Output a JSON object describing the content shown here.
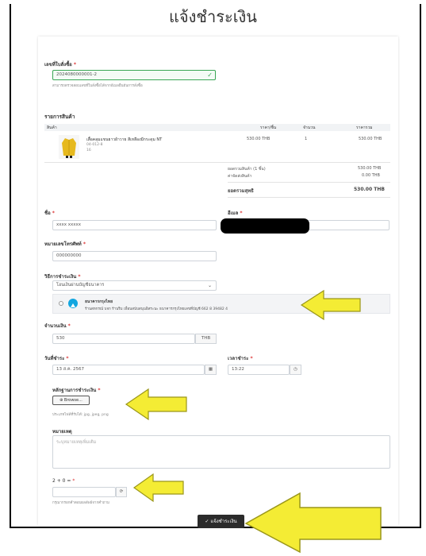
{
  "page": {
    "title": "แจ้งชำระเงิน"
  },
  "order": {
    "label": "เลขที่ใบสั่งซื้อ",
    "value": "2024080000001-2",
    "help": "สามารถตรวจสอบเลขที่ใบสั่งซื้อได้จากอีเมลยืนยันการสั่งซื้อ"
  },
  "items": {
    "section_title": "รายการสินค้า",
    "headers": {
      "product": "สินค้า",
      "price": "ราคา/ชิ้น",
      "qty": "จำนวน",
      "total": "ราคารวม"
    },
    "rows": [
      {
        "name": "เสื้อคลุมแขนยาวผ้าวาย สีเหลืองมีกระดุม NT",
        "sku": "04-012-8",
        "variant": "16",
        "price": "530.00 THB",
        "qty": "1",
        "total": "530.00 THB"
      }
    ],
    "subtotal_label": "ยอดรวมสินค้า (1 ชิ้น)",
    "subtotal_value": "530.00 THB",
    "shipping_label": "ค่าจัดส่งสินค้า",
    "shipping_value": "0.00 THB",
    "grand_label": "ยอดรวมสุทธิ",
    "grand_value": "530.00 THB"
  },
  "name": {
    "label": "ชื่อ",
    "value": "xxxx xxxxx"
  },
  "email": {
    "label": "อีเมล"
  },
  "phone": {
    "label": "หมายเลขโทรศัพท์",
    "value": "000000000"
  },
  "method": {
    "label": "วิธีการชำระเงิน",
    "selected": "โอนเงินผ่านบัญชีธนาคาร",
    "bank_name": "ธนาคารกรุงไทย",
    "bank_detail": "ร้านสหกรณ์ บจก ร้านริม เพื่อนสนับสนุนอิสระนะ ธนาคารกรุงไทยเลขที่บัญชี 662 8 39482 4"
  },
  "amount": {
    "label": "จำนวนเงิน",
    "value": "530",
    "unit": "THB"
  },
  "date": {
    "label": "วันที่ชำระ",
    "value": "13 ส.ค. 2567"
  },
  "time": {
    "label": "เวลาชำระ",
    "value": "13:22"
  },
  "proof": {
    "label": "หลักฐานการชำระเงิน",
    "browse": "Browse...",
    "help": "ประเภทไฟล์ที่รับได้: jpg, jpeg, png"
  },
  "note": {
    "label": "หมายเหตุ",
    "placeholder": "ระบุหมายเหตุเพิ่มเติม"
  },
  "captcha": {
    "label": "2 + 0 =",
    "help": "กรุณากรอกคำตอบผลลัพธ์จากคำถาม"
  },
  "submit": {
    "label": "แจ้งชำระเงิน"
  },
  "colors": {
    "arrow": "#f4ec34",
    "arrow_stroke": "#9a961a",
    "valid": "#3aa655",
    "submit_bg": "#2b2b2b"
  }
}
